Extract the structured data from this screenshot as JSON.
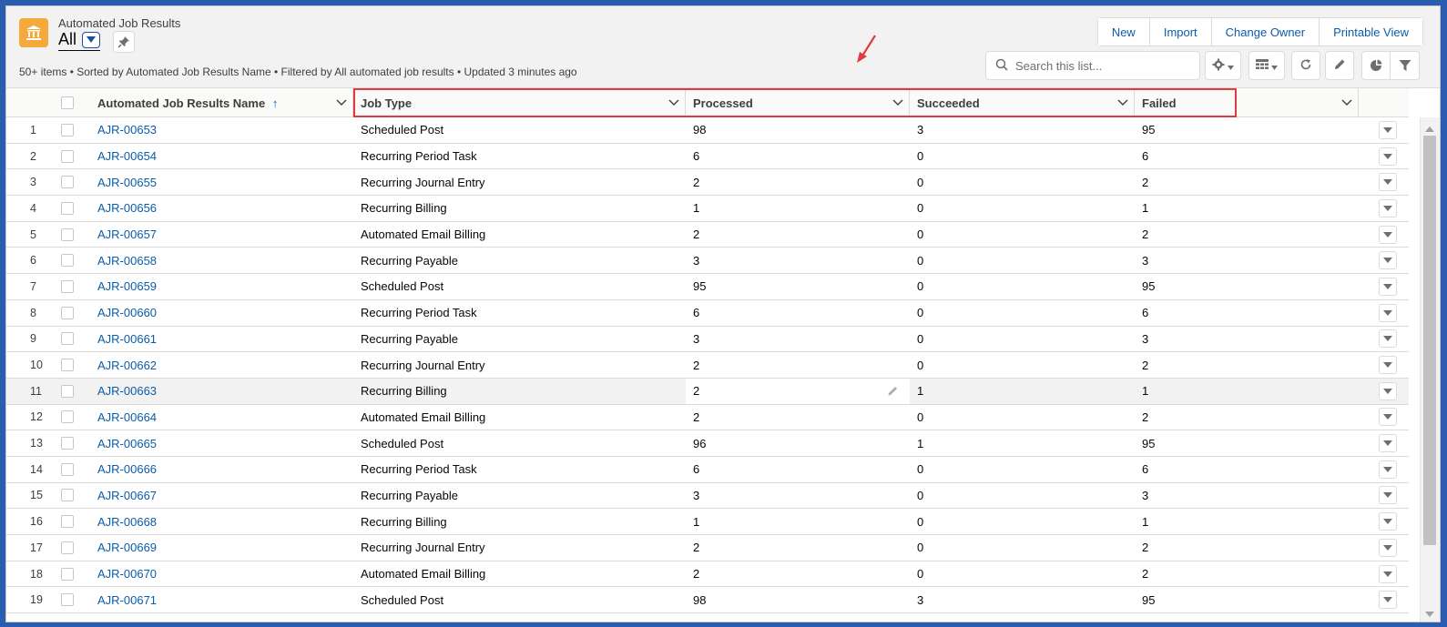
{
  "header": {
    "object_label": "Automated Job Results",
    "list_view": "All",
    "meta": "50+ items • Sorted by Automated Job Results Name • Filtered by All automated job results • Updated 3 minutes ago",
    "icon": "bank-icon"
  },
  "actions": {
    "new": "New",
    "import": "Import",
    "change_owner": "Change Owner",
    "printable_view": "Printable View"
  },
  "search": {
    "placeholder": "Search this list..."
  },
  "columns": {
    "name": "Automated Job Results Name",
    "job_type": "Job Type",
    "processed": "Processed",
    "succeeded": "Succeeded",
    "failed": "Failed"
  },
  "colors": {
    "link": "#0b5cab",
    "annotation": "#e03a3e",
    "app_icon": "#f4a93a"
  },
  "rows": [
    {
      "n": "1",
      "name": "AJR-00653",
      "type": "Scheduled Post",
      "processed": "98",
      "succeeded": "3",
      "failed": "95"
    },
    {
      "n": "2",
      "name": "AJR-00654",
      "type": "Recurring Period Task",
      "processed": "6",
      "succeeded": "0",
      "failed": "6"
    },
    {
      "n": "3",
      "name": "AJR-00655",
      "type": "Recurring Journal Entry",
      "processed": "2",
      "succeeded": "0",
      "failed": "2"
    },
    {
      "n": "4",
      "name": "AJR-00656",
      "type": "Recurring Billing",
      "processed": "1",
      "succeeded": "0",
      "failed": "1"
    },
    {
      "n": "5",
      "name": "AJR-00657",
      "type": "Automated Email Billing",
      "processed": "2",
      "succeeded": "0",
      "failed": "2"
    },
    {
      "n": "6",
      "name": "AJR-00658",
      "type": "Recurring Payable",
      "processed": "3",
      "succeeded": "0",
      "failed": "3"
    },
    {
      "n": "7",
      "name": "AJR-00659",
      "type": "Scheduled Post",
      "processed": "95",
      "succeeded": "0",
      "failed": "95"
    },
    {
      "n": "8",
      "name": "AJR-00660",
      "type": "Recurring Period Task",
      "processed": "6",
      "succeeded": "0",
      "failed": "6"
    },
    {
      "n": "9",
      "name": "AJR-00661",
      "type": "Recurring Payable",
      "processed": "3",
      "succeeded": "0",
      "failed": "3"
    },
    {
      "n": "10",
      "name": "AJR-00662",
      "type": "Recurring Journal Entry",
      "processed": "2",
      "succeeded": "0",
      "failed": "2"
    },
    {
      "n": "11",
      "name": "AJR-00663",
      "type": "Recurring Billing",
      "processed": "2",
      "succeeded": "1",
      "failed": "1"
    },
    {
      "n": "12",
      "name": "AJR-00664",
      "type": "Automated Email Billing",
      "processed": "2",
      "succeeded": "0",
      "failed": "2"
    },
    {
      "n": "13",
      "name": "AJR-00665",
      "type": "Scheduled Post",
      "processed": "96",
      "succeeded": "1",
      "failed": "95"
    },
    {
      "n": "14",
      "name": "AJR-00666",
      "type": "Recurring Period Task",
      "processed": "6",
      "succeeded": "0",
      "failed": "6"
    },
    {
      "n": "15",
      "name": "AJR-00667",
      "type": "Recurring Payable",
      "processed": "3",
      "succeeded": "0",
      "failed": "3"
    },
    {
      "n": "16",
      "name": "AJR-00668",
      "type": "Recurring Billing",
      "processed": "1",
      "succeeded": "0",
      "failed": "1"
    },
    {
      "n": "17",
      "name": "AJR-00669",
      "type": "Recurring Journal Entry",
      "processed": "2",
      "succeeded": "0",
      "failed": "2"
    },
    {
      "n": "18",
      "name": "AJR-00670",
      "type": "Automated Email Billing",
      "processed": "2",
      "succeeded": "0",
      "failed": "2"
    },
    {
      "n": "19",
      "name": "AJR-00671",
      "type": "Scheduled Post",
      "processed": "98",
      "succeeded": "3",
      "failed": "95"
    }
  ]
}
